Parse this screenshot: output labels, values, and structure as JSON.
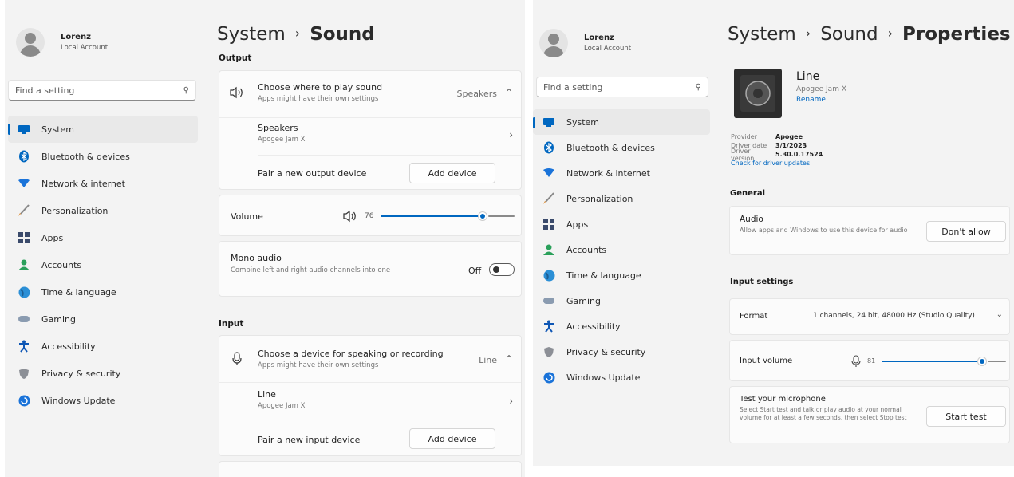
{
  "left": {
    "profile": {
      "name": "Lorenz",
      "type": "Local Account"
    },
    "search": {
      "placeholder": "Find a setting"
    },
    "nav": [
      {
        "label": "System",
        "icon": "system-icon",
        "active": true
      },
      {
        "label": "Bluetooth & devices",
        "icon": "bluetooth-icon"
      },
      {
        "label": "Network & internet",
        "icon": "network-icon"
      },
      {
        "label": "Personalization",
        "icon": "brush-icon"
      },
      {
        "label": "Apps",
        "icon": "apps-icon"
      },
      {
        "label": "Accounts",
        "icon": "accounts-icon"
      },
      {
        "label": "Time & language",
        "icon": "globe-icon"
      },
      {
        "label": "Gaming",
        "icon": "gamepad-icon"
      },
      {
        "label": "Accessibility",
        "icon": "accessibility-icon"
      },
      {
        "label": "Privacy & security",
        "icon": "shield-icon"
      },
      {
        "label": "Windows Update",
        "icon": "update-icon"
      }
    ],
    "breadcrumb": {
      "parent": "System",
      "current": "Sound",
      "separator": "›"
    },
    "output": {
      "title": "Output",
      "choose": {
        "title": "Choose where to play sound",
        "subtitle": "Apps might have their own settings",
        "value": "Speakers"
      },
      "device": {
        "title": "Speakers",
        "subtitle": "Apogee Jam X"
      },
      "pair": {
        "label": "Pair a new output device",
        "button": "Add device"
      },
      "volume": {
        "label": "Volume",
        "value": "76",
        "level": 0.76
      },
      "mono": {
        "title": "Mono audio",
        "subtitle": "Combine left and right audio channels into one",
        "state": "Off"
      }
    },
    "input": {
      "title": "Input",
      "choose": {
        "title": "Choose a device for speaking or recording",
        "subtitle": "Apps might have their own settings",
        "value": "Line"
      },
      "device": {
        "title": "Line",
        "subtitle": "Apogee Jam X"
      },
      "pair": {
        "label": "Pair a new input device",
        "button": "Add device"
      }
    }
  },
  "right": {
    "profile": {
      "name": "Lorenz",
      "type": "Local Account"
    },
    "search": {
      "placeholder": "Find a setting"
    },
    "nav": [
      {
        "label": "System",
        "icon": "system-icon",
        "active": true
      },
      {
        "label": "Bluetooth & devices",
        "icon": "bluetooth-icon"
      },
      {
        "label": "Network & internet",
        "icon": "network-icon"
      },
      {
        "label": "Personalization",
        "icon": "brush-icon"
      },
      {
        "label": "Apps",
        "icon": "apps-icon"
      },
      {
        "label": "Accounts",
        "icon": "accounts-icon"
      },
      {
        "label": "Time & language",
        "icon": "globe-icon"
      },
      {
        "label": "Gaming",
        "icon": "gamepad-icon"
      },
      {
        "label": "Accessibility",
        "icon": "accessibility-icon"
      },
      {
        "label": "Privacy & security",
        "icon": "shield-icon"
      },
      {
        "label": "Windows Update",
        "icon": "update-icon"
      }
    ],
    "breadcrumb": {
      "first": "System",
      "second": "Sound",
      "current": "Properties",
      "separator": "›"
    },
    "device": {
      "name": "Line",
      "model": "Apogee Jam X",
      "rename": "Rename"
    },
    "info": {
      "provider_label": "Provider",
      "provider": "Apogee",
      "date_label": "Driver date",
      "date": "3/1/2023",
      "version_label": "Driver version",
      "version": "5.30.0.17524",
      "check_link": "Check for driver updates"
    },
    "general": {
      "title": "General",
      "audio": {
        "title": "Audio",
        "subtitle": "Allow apps and Windows to use this device for audio",
        "button": "Don't allow"
      }
    },
    "input_settings": {
      "title": "Input settings",
      "format": {
        "label": "Format",
        "value": "1 channels, 24 bit, 48000 Hz (Studio Quality)"
      },
      "volume": {
        "label": "Input volume",
        "value": "81",
        "level": 0.81
      },
      "test": {
        "title": "Test your microphone",
        "subtitle": "Select Start test and talk or play audio at your normal volume for at least a few seconds, then select Stop test",
        "button": "Start test"
      }
    }
  },
  "colors": {
    "accent": "#0067c0",
    "window_bg": "#f3f3f3",
    "card_bg": "#fbfbfb"
  }
}
